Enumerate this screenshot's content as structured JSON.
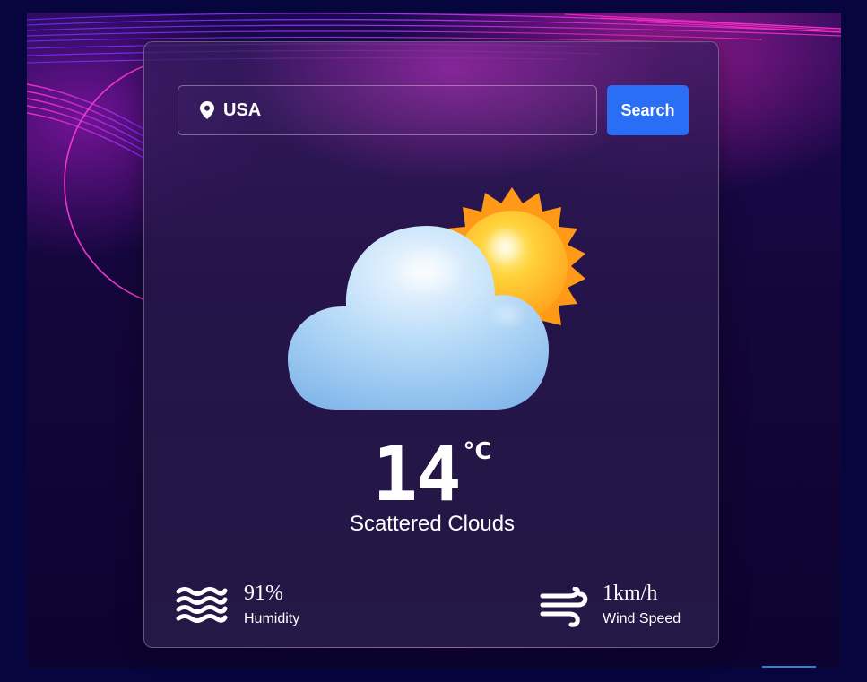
{
  "search": {
    "value": "USA",
    "button_label": "Search",
    "icon": "location-pin-icon"
  },
  "weather": {
    "icon": "sun-behind-cloud-icon",
    "temperature": "14",
    "unit": "°C",
    "description": "Scattered Clouds"
  },
  "stats": {
    "humidity": {
      "value": "91%",
      "label": "Humidity",
      "icon": "water-waves-icon"
    },
    "wind": {
      "value": "1km/h",
      "label": "Wind Speed",
      "icon": "wind-icon"
    }
  },
  "colors": {
    "accent": "#2a6ef5",
    "text": "#ffffff",
    "page_background": "#06053e"
  }
}
